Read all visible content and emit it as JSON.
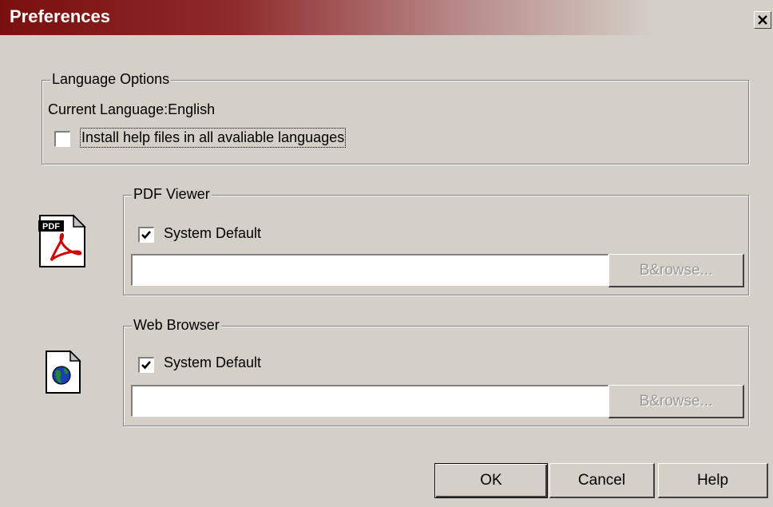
{
  "window": {
    "title": "Preferences"
  },
  "language_options": {
    "group_label": "Language Options",
    "current_language_text": "Current Language:English",
    "install_help_label": "Install help files in all avaliable languages",
    "install_help_checked": false
  },
  "pdf_viewer": {
    "group_label": "PDF Viewer",
    "system_default_label": "System Default",
    "system_default_checked": true,
    "path_value": "",
    "browse_label": "B&rowse..."
  },
  "web_browser": {
    "group_label": "Web Browser",
    "system_default_label": "System Default",
    "system_default_checked": true,
    "path_value": "",
    "browse_label": "B&rowse..."
  },
  "buttons": {
    "ok_label": "OK",
    "cancel_label": "Cancel",
    "help_label": "Help"
  },
  "icons": {
    "pdf_icon_label": "PDF",
    "pdf_icon": "pdf-document-icon",
    "web_icon": "web-document-globe-icon",
    "close_icon": "close-x-icon"
  },
  "colors": {
    "titlebar_start": "#7a0f0f",
    "dialog_bg": "#d4d0c8"
  }
}
